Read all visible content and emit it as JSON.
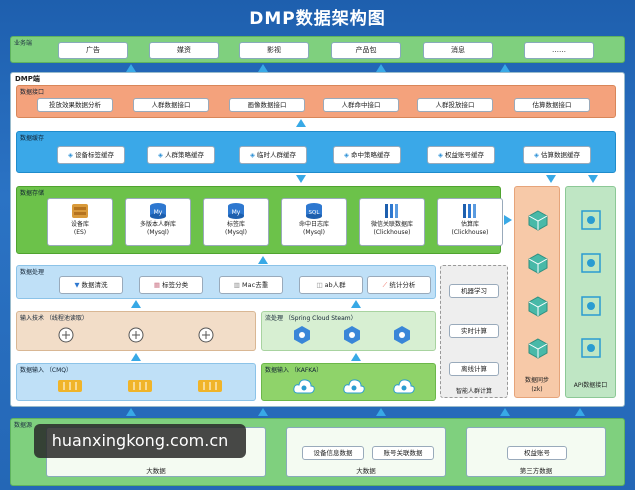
{
  "title": "DMP数据架构图",
  "business": {
    "label": "业务端",
    "items": [
      "广告",
      "媒资",
      "影视",
      "产品包",
      "消息",
      "……"
    ]
  },
  "dmp": {
    "label": "DMP端",
    "api_layer": {
      "label": "数据接口",
      "items": [
        "投放效果数据分析",
        "人群数据接口",
        "画像数据接口",
        "人群命中接口",
        "人群投放接口",
        "估算数据接口"
      ]
    },
    "cache_layer": {
      "label": "数据缓存",
      "items": [
        "设备标签缓存",
        "人群策略缓存",
        "临时人群缓存",
        "命中策略缓存",
        "权益账号缓存",
        "估算数据缓存"
      ]
    },
    "storage_layer": {
      "label": "数据存储",
      "items": [
        {
          "line1": "设备库",
          "line2": "(ES)"
        },
        {
          "line1": "多版本人群库",
          "line2": "(Mysql)"
        },
        {
          "line1": "标签库",
          "line2": "(Mysql)"
        },
        {
          "line1": "命中日志库",
          "line2": "(Mysql)"
        },
        {
          "line1": "微信关联数据库",
          "line2": "(Clickhouse)"
        },
        {
          "line1": "估算库",
          "line2": "(Clickhouse)"
        }
      ]
    },
    "processing_layer": {
      "label": "数据处理",
      "items": [
        "数据清洗",
        "标签分类",
        "Mac去重",
        "ab人群",
        "统计分析"
      ]
    },
    "input_tech": {
      "label": "输入技术 （线程池读取）"
    },
    "stream": {
      "label": "流处理 （Spring Cloud Steam）"
    },
    "input_cmq": {
      "label": "数据输入 （CMQ）"
    },
    "input_kafka": {
      "label": "数据输入 （KAFKA）"
    },
    "smart": {
      "items": [
        "机器学习",
        "实时计算",
        "离线计算"
      ],
      "label": "智能人群计算"
    },
    "sync": {
      "label": "数据同步",
      "sub": "(zk)"
    },
    "api_service": {
      "label": "API数据接口"
    }
  },
  "sources": {
    "label": "数据源",
    "groups": [
      {
        "caption": "大数据",
        "items": []
      },
      {
        "caption": "大数据",
        "items": [
          "设备信息数据",
          "账号关联数据"
        ]
      },
      {
        "caption": "第三方数据",
        "items": [
          "权益账号"
        ]
      }
    ]
  },
  "watermark": "huanxingkong.com.cn",
  "colors": {
    "api": "#f4a27c",
    "cache": "#3aa8e8",
    "storage": "#6cc24a",
    "processing": "#bfe0f7",
    "accent_arrow": "#38a9e6",
    "business": "#7fd07e"
  }
}
